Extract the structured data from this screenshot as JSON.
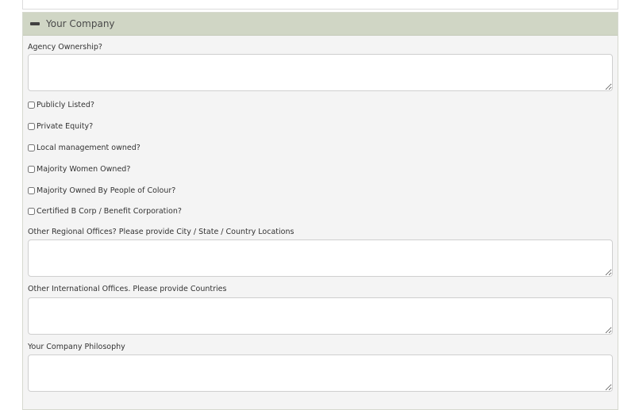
{
  "section": {
    "title": "Your Company"
  },
  "fields": {
    "agency_ownership": {
      "label": "Agency Ownership?",
      "value": ""
    },
    "regional_offices": {
      "label": "Other Regional Offices? Please provide City / State / Country Locations",
      "value": ""
    },
    "international_offices": {
      "label": "Other International Offices. Please provide Countries",
      "value": ""
    },
    "philosophy": {
      "label": "Your Company Philosophy",
      "value": ""
    }
  },
  "checkboxes": [
    {
      "label": "Publicly Listed?",
      "checked": false
    },
    {
      "label": "Private Equity?",
      "checked": false
    },
    {
      "label": "Local management owned?",
      "checked": false
    },
    {
      "label": "Majority Women Owned?",
      "checked": false
    },
    {
      "label": "Majority Owned By People of Colour?",
      "checked": false
    },
    {
      "label": "Certified B Corp / Benefit Corporation?",
      "checked": false
    }
  ],
  "colors": {
    "header_bg": "#d0d6c5",
    "panel_bg": "#f4f4f4"
  }
}
